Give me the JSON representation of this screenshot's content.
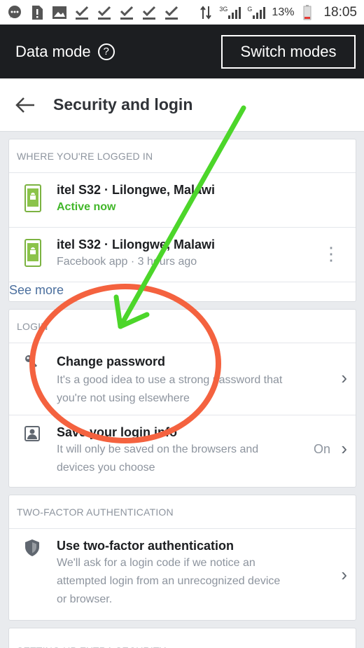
{
  "status_bar": {
    "network_3g": "3G",
    "network_g": "G",
    "battery_percent": "13%",
    "time": "18:05"
  },
  "data_mode": {
    "title": "Data mode",
    "help_glyph": "?",
    "switch_label": "Switch modes"
  },
  "header": {
    "title": "Security and login"
  },
  "logged_in": {
    "heading": "WHERE YOU'RE LOGGED IN",
    "devices": [
      {
        "name": "itel S32 · Lilongwe, Malawi",
        "status": "Active now"
      },
      {
        "name": "itel S32 · Lilongwe, Malawi",
        "status": "Facebook app · 3 hours ago"
      }
    ],
    "see_more": "See more"
  },
  "login": {
    "heading": "LOGIN",
    "change_password": {
      "title": "Change password",
      "desc_line1": "It's a good idea to use a strong password that",
      "desc_line2": "you're not using elsewhere"
    },
    "save_login": {
      "title": "Save your login info",
      "desc_line1": "It will only be saved on the browsers and",
      "desc_line2": "devices you choose",
      "state": "On"
    }
  },
  "two_factor": {
    "heading": "TWO-FACTOR AUTHENTICATION",
    "item": {
      "title": "Use two-factor authentication",
      "desc_line1": "We'll ask for a login code if we notice an",
      "desc_line2": "attempted login from an unrecognized device",
      "desc_line3": "or browser."
    }
  },
  "extra_security": {
    "heading": "SETTING UP EXTRA SECURITY"
  },
  "icons": {
    "chevron": "›",
    "more": "⋮"
  },
  "colors": {
    "active_green": "#42b72a",
    "arrow_green": "#4cd62a",
    "circle_red": "#f4623f",
    "dark_bar": "#1c1e21"
  }
}
